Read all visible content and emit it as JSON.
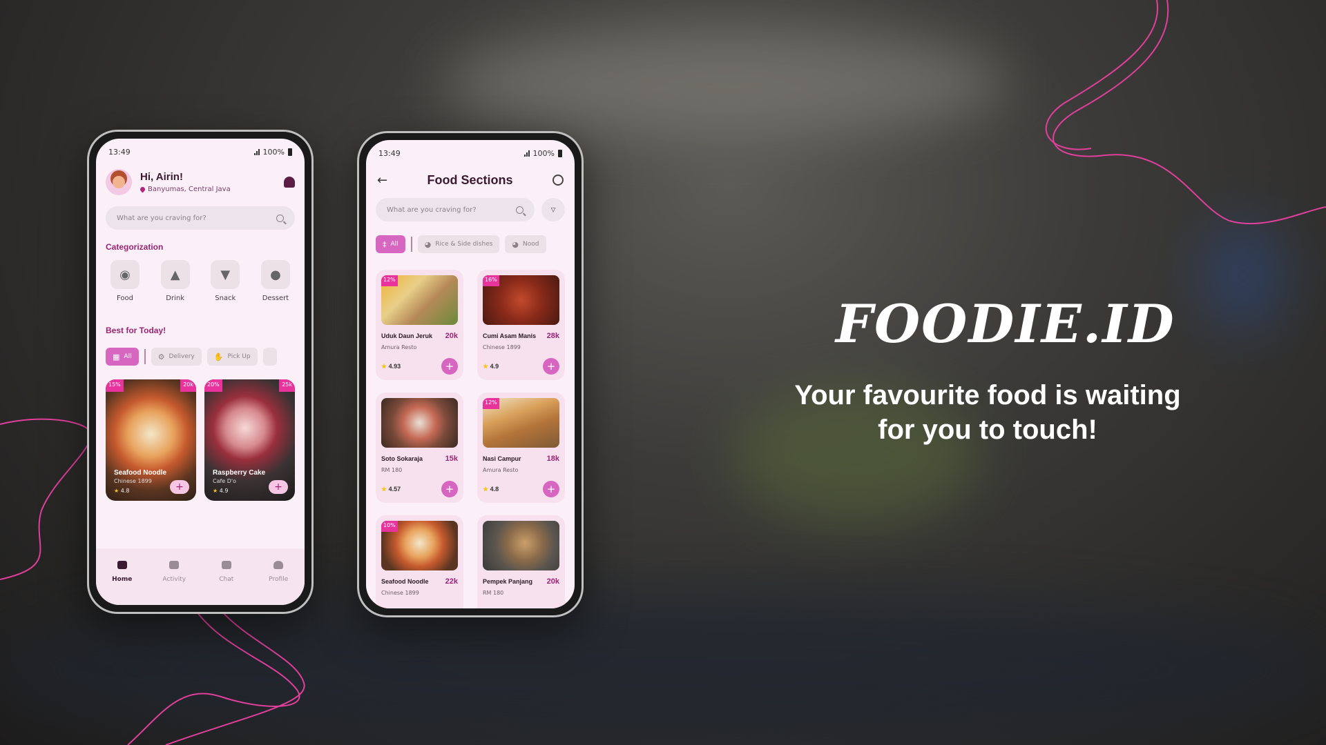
{
  "phone1": {
    "time": "13:49",
    "battery": "100%",
    "greeting": "Hi, Airin!",
    "location": "Banyumas, Central Java",
    "search_placeholder": "What are you craving for?",
    "categorization_title": "Categorization",
    "categories": [
      {
        "label": "Food",
        "icon": "food-icon"
      },
      {
        "label": "Drink",
        "icon": "drink-icon"
      },
      {
        "label": "Snack",
        "icon": "snack-icon"
      },
      {
        "label": "Dessert",
        "icon": "dessert-icon"
      }
    ],
    "best_title": "Best for Today!",
    "chips": [
      "All",
      "Delivery",
      "Pick Up"
    ],
    "best_items": [
      {
        "name": "Seafood Noodle",
        "resto": "Chinese 1899",
        "rating": "4.8",
        "discount": "15%",
        "price": "20k"
      },
      {
        "name": "Raspberry Cake",
        "resto": "Cafe D'o",
        "rating": "4.9",
        "discount": "20%",
        "price": "25k"
      }
    ],
    "nav": [
      "Home",
      "Activity",
      "Chat",
      "Profile"
    ]
  },
  "phone2": {
    "time": "13:49",
    "battery": "100%",
    "title": "Food Sections",
    "search_placeholder": "What are you craving for?",
    "chips": [
      "All",
      "Rice & Side dishes",
      "Nood"
    ],
    "items": [
      {
        "name": "Uduk Daun Jeruk",
        "price": "20k",
        "resto": "Amura Resto",
        "rating": "4.93",
        "discount": "12%"
      },
      {
        "name": "Cumi Asam Manis",
        "price": "28k",
        "resto": "Chinese 1899",
        "rating": "4.9",
        "discount": "16%"
      },
      {
        "name": "Soto Sokaraja",
        "price": "15k",
        "resto": "RM 180",
        "rating": "4.57",
        "discount": ""
      },
      {
        "name": "Nasi Campur",
        "price": "18k",
        "resto": "Amura Resto",
        "rating": "4.8",
        "discount": "12%"
      },
      {
        "name": "Seafood Noodle",
        "price": "22k",
        "resto": "Chinese 1899",
        "rating": "",
        "discount": "10%"
      },
      {
        "name": "Pempek Panjang",
        "price": "20k",
        "resto": "RM 180",
        "rating": "",
        "discount": ""
      }
    ]
  },
  "hero": {
    "brand": "FOODIE.ID",
    "tagline_line1": "Your favourite food is waiting",
    "tagline_line2": "for you to touch!"
  },
  "colors": {
    "accent": "#d766c0",
    "badge": "#e8339d",
    "wave": "#e0409c"
  }
}
